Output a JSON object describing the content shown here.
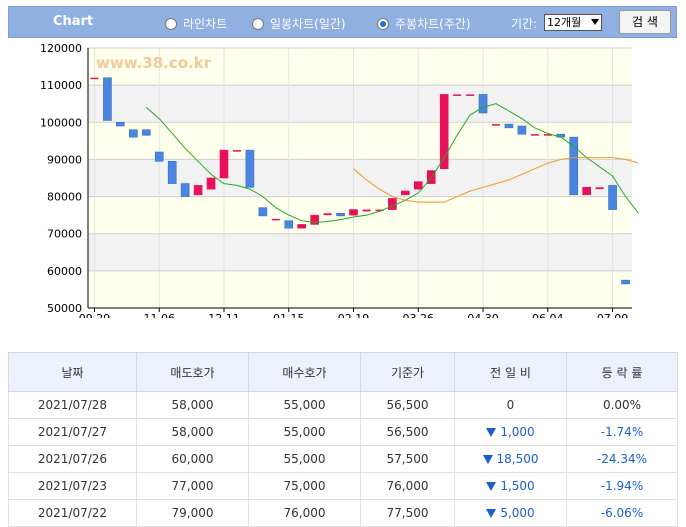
{
  "toolbar": {
    "title": "Chart",
    "radios": [
      {
        "label": "라인차트",
        "selected": false
      },
      {
        "label": "일봉차트(일간)",
        "selected": false
      },
      {
        "label": "주봉차트(주간)",
        "selected": true
      }
    ],
    "period_label": "기간:",
    "period_value": "12개월",
    "search_label": "검 색"
  },
  "colors": {
    "up": "#e8105a",
    "down": "#4a86e0",
    "ma_short": "#22aa22",
    "ma_long": "#ee9922",
    "band": "#ffffee"
  },
  "chart_data": {
    "type": "candlestick",
    "watermark": "www.38.co.kr",
    "ylim": [
      50000,
      120000
    ],
    "yticks": [
      50000,
      60000,
      70000,
      80000,
      90000,
      100000,
      110000,
      120000
    ],
    "xtick_labels": [
      {
        "label": "09.29",
        "index": 0
      },
      {
        "label": "11.06",
        "index": 5
      },
      {
        "label": "12.11",
        "index": 10
      },
      {
        "label": "01.15",
        "index": 15
      },
      {
        "label": "02.19",
        "index": 20
      },
      {
        "label": "03.26",
        "index": 25
      },
      {
        "label": "04.30",
        "index": 30
      },
      {
        "label": "06.04",
        "index": 35
      },
      {
        "label": "07.09",
        "index": 40
      }
    ],
    "candles": [
      {
        "open": 112000,
        "close": 112000
      },
      {
        "open": 112000,
        "close": 100500
      },
      {
        "open": 100000,
        "close": 99000
      },
      {
        "open": 98000,
        "close": 96000
      },
      {
        "open": 98000,
        "close": 96500
      },
      {
        "open": 92000,
        "close": 89500
      },
      {
        "open": 89500,
        "close": 83500
      },
      {
        "open": 83500,
        "close": 80000
      },
      {
        "open": 80500,
        "close": 83000
      },
      {
        "open": 82000,
        "close": 85000
      },
      {
        "open": 85000,
        "close": 92500
      },
      {
        "open": 92500,
        "close": 92500
      },
      {
        "open": 92500,
        "close": 82500
      },
      {
        "open": 77000,
        "close": 74800
      },
      {
        "open": 74000,
        "close": 74000
      },
      {
        "open": 73500,
        "close": 71500
      },
      {
        "open": 71500,
        "close": 72500
      },
      {
        "open": 72500,
        "close": 75000
      },
      {
        "open": 75000,
        "close": 75500
      },
      {
        "open": 75500,
        "close": 74800
      },
      {
        "open": 75000,
        "close": 76500
      },
      {
        "open": 76000,
        "close": 76500
      },
      {
        "open": 76500,
        "close": 76500
      },
      {
        "open": 76500,
        "close": 79500
      },
      {
        "open": 80500,
        "close": 81500
      },
      {
        "open": 82000,
        "close": 84000
      },
      {
        "open": 83500,
        "close": 87000
      },
      {
        "open": 87500,
        "close": 107500
      },
      {
        "open": 107500,
        "close": 107500
      },
      {
        "open": 107500,
        "close": 107500
      },
      {
        "open": 107500,
        "close": 102500
      },
      {
        "open": 99500,
        "close": 99500
      },
      {
        "open": 99500,
        "close": 98500
      },
      {
        "open": 99000,
        "close": 96800
      },
      {
        "open": 96800,
        "close": 96800
      },
      {
        "open": 96800,
        "close": 96800
      },
      {
        "open": 96800,
        "close": 96000
      },
      {
        "open": 96000,
        "close": 80500
      },
      {
        "open": 80500,
        "close": 82500
      },
      {
        "open": 82000,
        "close": 82500
      },
      {
        "open": 83000,
        "close": 76500
      },
      {
        "open": 57500,
        "close": 56500
      }
    ],
    "series": [
      {
        "values": [
          null,
          null,
          null,
          null,
          104000,
          101000,
          97000,
          93000,
          89500,
          86000,
          83500,
          83000,
          82000,
          80000,
          77000,
          75000,
          73500,
          73000,
          73300,
          73800,
          74500,
          75000,
          76000,
          77500,
          79000,
          81000,
          85000,
          90500,
          96500,
          102000,
          104000,
          105000,
          103000,
          101000,
          98500,
          97000,
          96000,
          93500,
          90500,
          88000,
          85500,
          80000,
          75500
        ]
      },
      {
        "values": [
          null,
          null,
          null,
          null,
          null,
          null,
          null,
          null,
          null,
          null,
          null,
          null,
          null,
          null,
          null,
          null,
          null,
          null,
          null,
          null,
          87500,
          84500,
          82000,
          80000,
          79000,
          78500,
          78500,
          78500,
          80000,
          81500,
          82500,
          83500,
          84500,
          86000,
          87500,
          89000,
          90000,
          90500,
          90500,
          90500,
          90500,
          90000,
          89000
        ]
      }
    ]
  },
  "table": {
    "headers": [
      "날짜",
      "매도호가",
      "매수호가",
      "기준가",
      "전 일 비",
      "등 락 률"
    ],
    "rows": [
      {
        "date": "2021/07/28",
        "ask": "58,000",
        "bid": "55,000",
        "base": "56,500",
        "change": "0",
        "change_down": false,
        "rate": "0.00%"
      },
      {
        "date": "2021/07/27",
        "ask": "58,000",
        "bid": "55,000",
        "base": "56,500",
        "change": "1,000",
        "change_down": true,
        "rate": "-1.74%"
      },
      {
        "date": "2021/07/26",
        "ask": "60,000",
        "bid": "55,000",
        "base": "57,500",
        "change": "18,500",
        "change_down": true,
        "rate": "-24.34%"
      },
      {
        "date": "2021/07/23",
        "ask": "77,000",
        "bid": "75,000",
        "base": "76,000",
        "change": "1,500",
        "change_down": true,
        "rate": "-1.94%"
      },
      {
        "date": "2021/07/22",
        "ask": "79,000",
        "bid": "76,000",
        "base": "77,500",
        "change": "5,000",
        "change_down": true,
        "rate": "-6.06%"
      }
    ]
  }
}
